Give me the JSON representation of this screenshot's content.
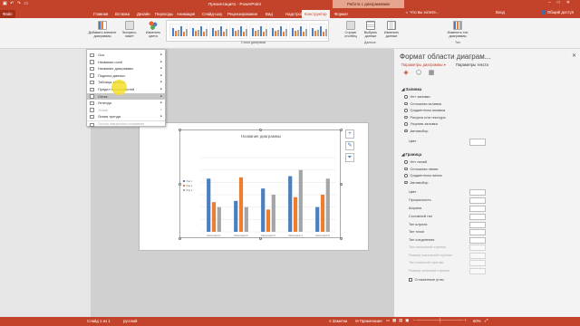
{
  "titlebar": {
    "title": "Презентация1 - PowerPoint",
    "context_label": "Работа с диаграммами",
    "user": "Вход",
    "qat_icons": [
      "save-icon",
      "undo-icon",
      "redo-icon",
      "present-icon"
    ]
  },
  "tabs": [
    {
      "label": "Файл",
      "active": false,
      "file": true
    },
    {
      "label": "Главная",
      "active": false
    },
    {
      "label": "Вставка",
      "active": false
    },
    {
      "label": "Дизайн",
      "active": false
    },
    {
      "label": "Переходы",
      "active": false
    },
    {
      "label": "Анимация",
      "active": false
    },
    {
      "label": "Слайд-шоу",
      "active": false
    },
    {
      "label": "Рецензирование",
      "active": false
    },
    {
      "label": "Вид",
      "active": false
    },
    {
      "label": "Надстройки",
      "active": false
    },
    {
      "label": "Конструктор",
      "active": true
    },
    {
      "label": "Формат",
      "active": false
    }
  ],
  "search_label": "Что вы хотите...",
  "share_label": "Общий доступ",
  "ribbon": {
    "add_element": "Добавить элемент диаграммы",
    "express": "Экспресс-макет",
    "change_colors": "Изменить цвета",
    "group_styles": "Стили диаграмм",
    "switch_rowcol": "Строка/ столбец",
    "select_data": "Выбрать данные",
    "edit_data": "Изменить данные",
    "change_type": "Изменить тип диаграммы",
    "group_data": "Данные",
    "group_type": "Тип"
  },
  "menu": {
    "items": [
      {
        "label": "Оси",
        "disabled": false,
        "highlighted": false
      },
      {
        "label": "Названия осей",
        "disabled": false,
        "highlighted": false
      },
      {
        "label": "Название диаграммы",
        "disabled": false,
        "highlighted": false
      },
      {
        "label": "Подписи данных",
        "disabled": false,
        "highlighted": false
      },
      {
        "label": "Таблица данных",
        "disabled": false,
        "highlighted": false
      },
      {
        "label": "Предел погрешностей",
        "disabled": false,
        "highlighted": false
      },
      {
        "label": "Сетка",
        "disabled": false,
        "highlighted": true
      },
      {
        "label": "Легенда",
        "disabled": false,
        "highlighted": false
      },
      {
        "label": "Линии",
        "disabled": true,
        "highlighted": false
      },
      {
        "label": "Линия тренда",
        "disabled": false,
        "highlighted": false
      },
      {
        "label": "Полосы повышения и понижения",
        "disabled": true,
        "highlighted": false
      }
    ]
  },
  "chart_data": {
    "type": "bar",
    "title": "Название диаграммы",
    "categories": [
      "Категория 1",
      "Категория 2",
      "Категория 3",
      "Категория 4",
      "Категория 5"
    ],
    "series": [
      {
        "name": "Ряд 1",
        "values": [
          4.3,
          2.5,
          3.5,
          4.5,
          2
        ]
      },
      {
        "name": "Ряд 2",
        "values": [
          2.4,
          4.4,
          1.8,
          2.8,
          3
        ]
      },
      {
        "name": "Ряд 3",
        "values": [
          2,
          2,
          3,
          5,
          4.3
        ]
      }
    ],
    "ylim": [
      0,
      6
    ],
    "grid": true,
    "legend_position": "left",
    "colors": [
      "#4a7fc1",
      "#ec7d31",
      "#a5a5a5"
    ]
  },
  "pane": {
    "title": "Формат области диаграм...",
    "subtab_main": "Параметры диаграммы",
    "subtab_text": "Параметры текста",
    "fill_section": "Заливка",
    "fill_options": [
      {
        "label": "Нет заливки",
        "on": false
      },
      {
        "label": "Сплошная заливка",
        "on": false
      },
      {
        "label": "Градиентная заливка",
        "on": false
      },
      {
        "label": "Рисунок или текстура",
        "on": false
      },
      {
        "label": "Узорная заливка",
        "on": false
      },
      {
        "label": "Автовыбор",
        "on": true
      }
    ],
    "color_label": "Цвет",
    "border_section": "Граница",
    "border_options": [
      {
        "label": "Нет линий",
        "on": false
      },
      {
        "label": "Сплошная линия",
        "on": false
      },
      {
        "label": "Градиентная линия",
        "on": false
      },
      {
        "label": "Автовыбор",
        "on": true
      }
    ],
    "border_fields": [
      {
        "label": "Цвет",
        "disabled": false
      },
      {
        "label": "Прозрачность",
        "disabled": false
      },
      {
        "label": "Ширина",
        "disabled": false
      },
      {
        "label": "Составной тип",
        "disabled": false
      },
      {
        "label": "Тип штриха",
        "disabled": false
      },
      {
        "label": "Тип точки",
        "disabled": false
      },
      {
        "label": "Тип соединения",
        "disabled": false
      },
      {
        "label": "Тип начальной стрелки",
        "disabled": true
      },
      {
        "label": "Размер начальной стрелки",
        "disabled": true
      },
      {
        "label": "Тип конечной стрелки",
        "disabled": true
      },
      {
        "label": "Размер конечной стрелки",
        "disabled": true
      }
    ],
    "rounded_corners": "Сглаженные углы"
  },
  "status": {
    "slide_info": "Слайд 1 из 1",
    "language": "русский",
    "notes": "Заметки",
    "comments": "Примечания",
    "zoom": "60%"
  }
}
